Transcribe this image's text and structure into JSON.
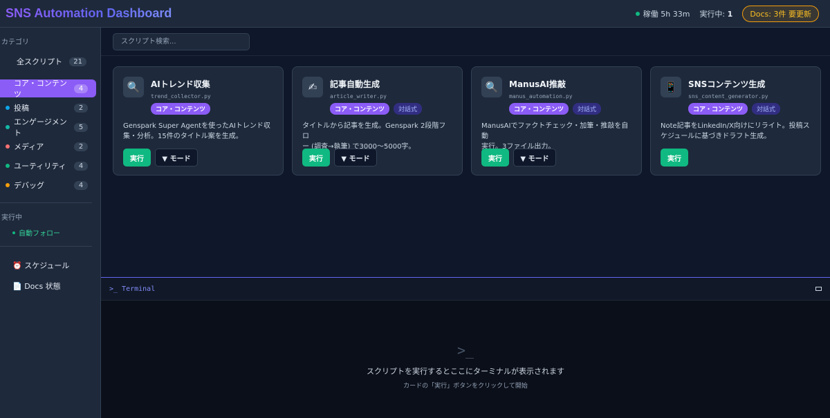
{
  "header": {
    "title": "SNS Automation Dashboard",
    "uptime": "稼働 5h 33m",
    "running_label": "実行中:",
    "running_count": "1",
    "docs_badge": "Docs: 3件 要更新"
  },
  "sidebar": {
    "category_heading": "カテゴリ",
    "all_label": "全スクリプト",
    "all_count": "21",
    "categories": [
      {
        "label": "コア・コンテンツ",
        "count": "4",
        "color": "#8b5cf6"
      },
      {
        "label": "投稿",
        "count": "2",
        "color": "#0ea5e9"
      },
      {
        "label": "エンゲージメント",
        "count": "5",
        "color": "#14b8a6"
      },
      {
        "label": "メディア",
        "count": "2",
        "color": "#f87171"
      },
      {
        "label": "ユーティリティ",
        "count": "4",
        "color": "#10b981"
      },
      {
        "label": "デバッグ",
        "count": "4",
        "color": "#f59e0b"
      }
    ],
    "running_heading": "実行中",
    "running_items": [
      "自動フォロー"
    ],
    "schedule_label": "⏰ スケジュール",
    "docs_label": "📄 Docs 状態"
  },
  "search": {
    "placeholder": "スクリプト検索..."
  },
  "cards": [
    {
      "icon": "🔍",
      "icon_name": "magnifier-icon",
      "title": "AIトレンド収集",
      "file": "trend_collector.py",
      "tag": "コア・コンテンツ",
      "dialog_tag": "",
      "desc_line1": "Genspark Super Agentを使ったAIトレンド収",
      "desc_line2": "集・分析。15件のタイトル案を生成。",
      "run": "実行",
      "mode": "▼ モード"
    },
    {
      "icon": "✍",
      "icon_name": "writing-hand-icon",
      "title": "記事自動生成",
      "file": "article_writer.py",
      "tag": "コア・コンテンツ",
      "dialog_tag": "対話式",
      "desc_line1": "タイトルから記事を生成。Genspark 2段階フロ",
      "desc_line2": "ー (調査→執筆) で3000〜5000字。",
      "run": "実行",
      "mode": "▼ モード"
    },
    {
      "icon": "🔍",
      "icon_name": "magnifier-icon",
      "title": "ManusAI推敲",
      "file": "manus_automation.py",
      "tag": "コア・コンテンツ",
      "dialog_tag": "対話式",
      "desc_line1": "ManusAIでファクトチェック・加筆・推敲を自動",
      "desc_line2": "実行。3ファイル出力。",
      "run": "実行",
      "mode": "▼ モード"
    },
    {
      "icon": "📱",
      "icon_name": "mobile-phone-icon",
      "title": "SNSコンテンツ生成",
      "file": "sns_content_generator.py",
      "tag": "コア・コンテンツ",
      "dialog_tag": "対話式",
      "desc_line1": "Note記事をLinkedIn/X向けにリライト。投稿ス",
      "desc_line2": "ケジュールに基づきドラフト生成。",
      "run": "実行",
      "mode": ""
    }
  ],
  "terminal": {
    "title": ">_ Terminal",
    "prompt": ">_",
    "message": "スクリプトを実行するとここにターミナルが表示されます",
    "hint": "カードの「実行」ボタンをクリックして開始"
  }
}
